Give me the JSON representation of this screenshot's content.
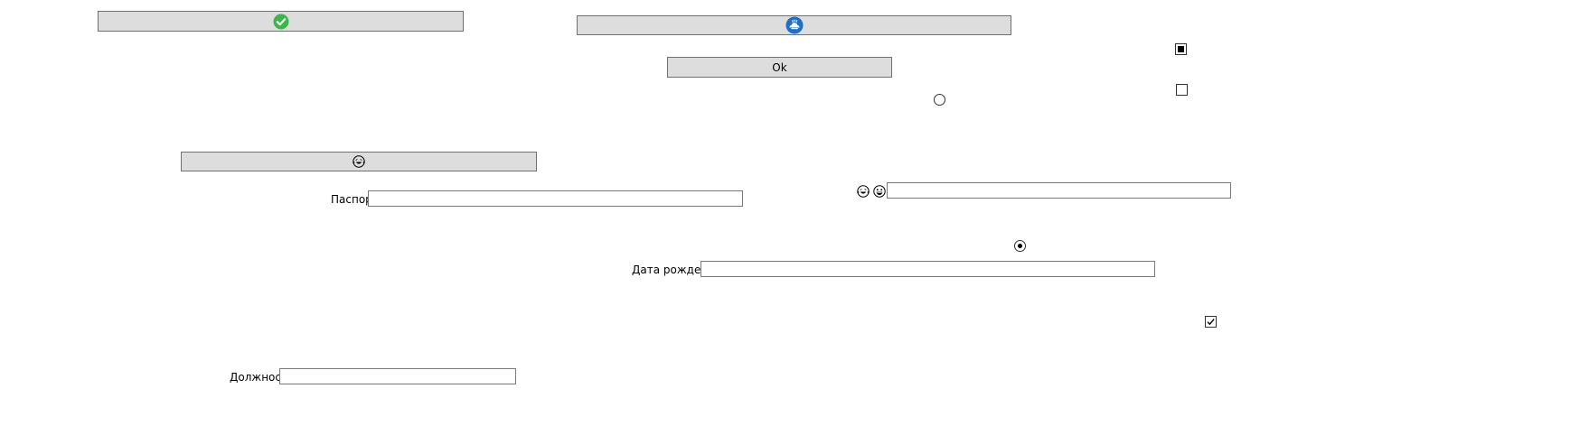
{
  "buttons": {
    "ok_label": "Ok",
    "success_icon": "check-circle-icon",
    "cloud_icon": "cloud-hand-icon",
    "emoji_icon": "laughing-face-icon"
  },
  "fields": {
    "passport_label": "Паспорт",
    "birthdate_label": "Дата рождения",
    "position_label": "Должность",
    "passport_value": "",
    "birthdate_value": "",
    "position_value": "",
    "emoji_field_value": ""
  },
  "emoji_prefix": {
    "icons": [
      "laughing-face-icon",
      "grinning-face-icon"
    ]
  },
  "checkboxes": [
    {
      "state": "indeterminate"
    },
    {
      "state": "unchecked"
    },
    {
      "state": "checked"
    }
  ],
  "radios": [
    {
      "state": "unchecked"
    },
    {
      "state": "checked"
    }
  ],
  "colors": {
    "button_bg": "#dddddd",
    "button_border": "#707070",
    "success_green": "#3cb54a",
    "cloud_blue": "#1e6fc6"
  }
}
